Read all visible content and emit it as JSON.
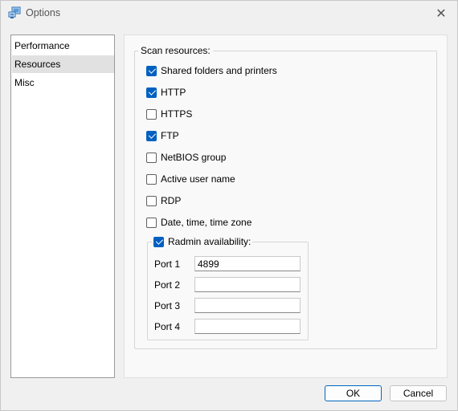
{
  "window": {
    "title": "Options"
  },
  "nav": {
    "items": [
      {
        "label": "Performance",
        "selected": false
      },
      {
        "label": "Resources",
        "selected": true
      },
      {
        "label": "Misc",
        "selected": false
      }
    ]
  },
  "scan": {
    "group_label": "Scan resources:",
    "options": [
      {
        "label": "Shared folders and printers",
        "checked": true
      },
      {
        "label": "HTTP",
        "checked": true
      },
      {
        "label": "HTTPS",
        "checked": false
      },
      {
        "label": "FTP",
        "checked": true
      },
      {
        "label": "NetBIOS group",
        "checked": false
      },
      {
        "label": "Active user name",
        "checked": false
      },
      {
        "label": "RDP",
        "checked": false
      },
      {
        "label": "Date, time, time zone",
        "checked": false
      }
    ],
    "radmin": {
      "label": "Radmin availability:",
      "checked": true,
      "ports": [
        {
          "label": "Port 1",
          "value": "4899"
        },
        {
          "label": "Port 2",
          "value": ""
        },
        {
          "label": "Port 3",
          "value": ""
        },
        {
          "label": "Port 4",
          "value": ""
        }
      ]
    }
  },
  "buttons": {
    "ok": "OK",
    "cancel": "Cancel"
  },
  "colors": {
    "accent": "#0060c0",
    "selected_nav": "#e1e1e1"
  }
}
